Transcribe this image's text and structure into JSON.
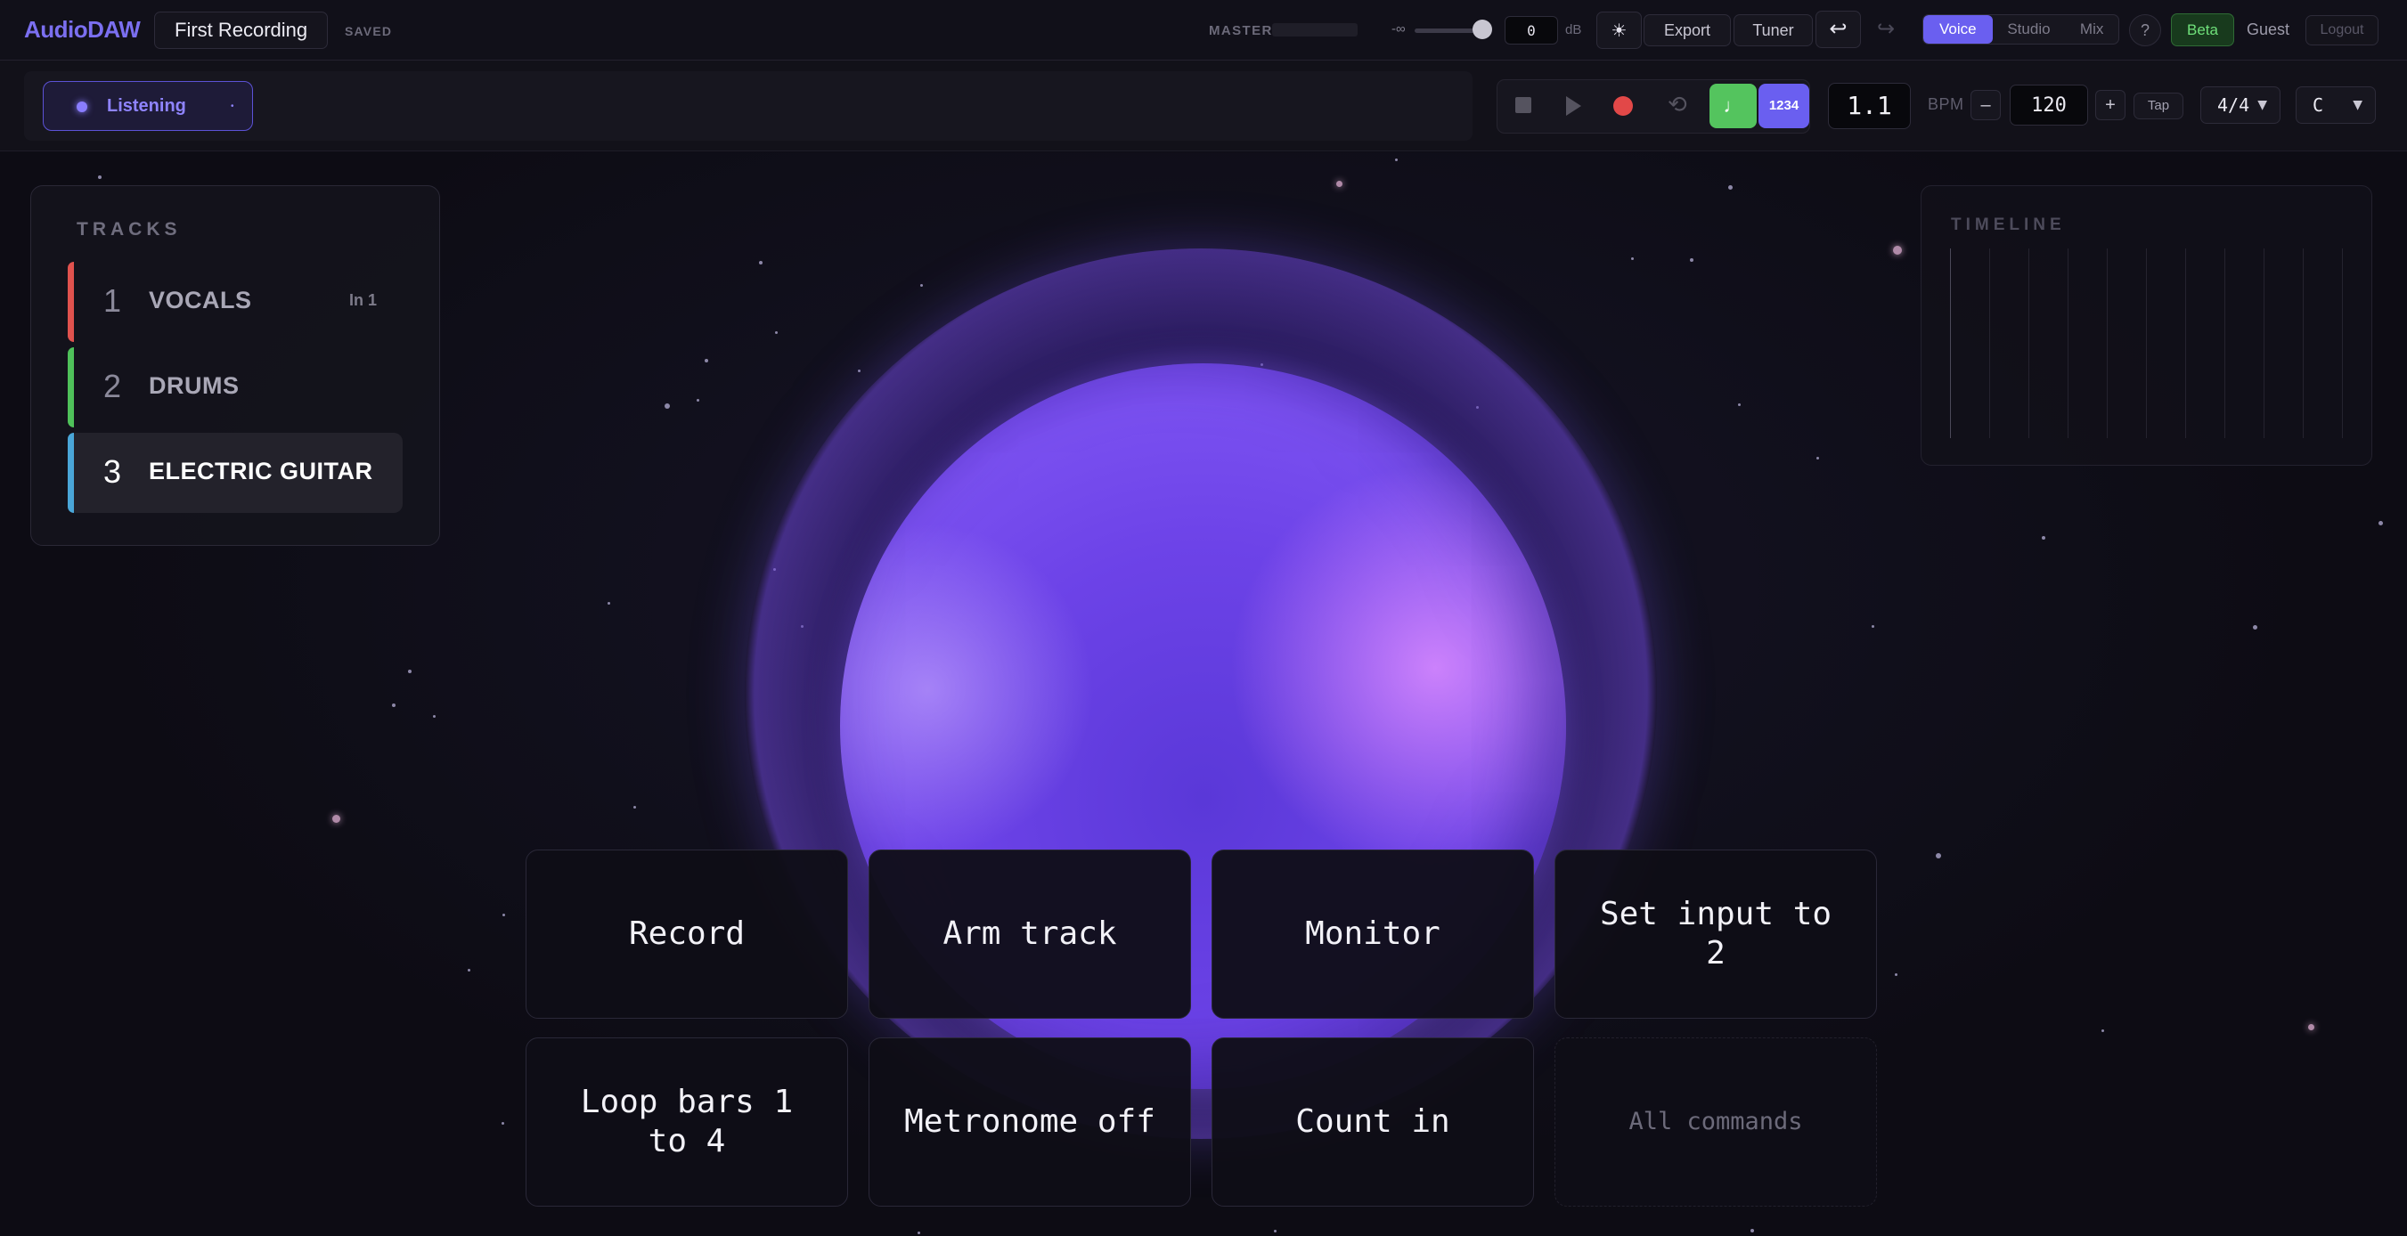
{
  "header": {
    "brand": "AudioDAW",
    "project_title": "First Recording",
    "save_status": "SAVED",
    "master_label": "MASTER",
    "volume_min_label": "-∞",
    "volume_db": "0",
    "db_unit": "dB",
    "export_label": "Export",
    "tuner_label": "Tuner",
    "modes": [
      "Voice",
      "Studio",
      "Mix"
    ],
    "active_mode": "Voice",
    "help_label": "?",
    "beta_label": "Beta",
    "user_label": "Guest",
    "logout_label": "Logout"
  },
  "status": {
    "listening_label": "Listening"
  },
  "transport": {
    "count_in_label": "1234",
    "position": "1.1",
    "bpm_label": "BPM",
    "bpm_minus": "–",
    "bpm_value": "120",
    "bpm_plus": "+",
    "tap_label": "Tap",
    "time_signature": "4/4",
    "key": "C"
  },
  "tracks": {
    "title": "TRACKS",
    "items": [
      {
        "number": "1",
        "name": "VOCALS",
        "input": "In 1",
        "color": "#e0524e"
      },
      {
        "number": "2",
        "name": "DRUMS",
        "input": "",
        "color": "#4fc15a"
      },
      {
        "number": "3",
        "name": "ELECTRIC GUITAR",
        "input": "",
        "color": "#4aa6d8"
      }
    ],
    "selected_index": 2
  },
  "timeline": {
    "title": "TIMELINE"
  },
  "commands": [
    "Record",
    "Arm track",
    "Monitor",
    "Set input to 2",
    "Loop bars 1 to 4",
    "Metronome off",
    "Count in",
    "All commands"
  ],
  "colors": {
    "accent": "#6a5ff0",
    "metronome_active": "#54c45e",
    "record": "#e24848"
  }
}
